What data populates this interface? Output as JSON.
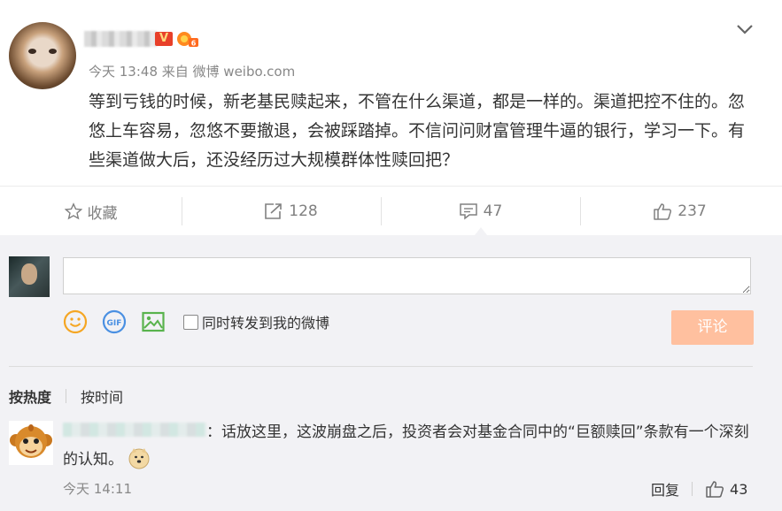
{
  "post": {
    "vip_label": "V",
    "meta": "今天 13:48 来自 微博 weibo.com",
    "text": "等到亏钱的时候，新老基民赎起来，不管在什么渠道，都是一样的。渠道把控不住的。忽悠上车容易，忽悠不要撤退，会被踩踏掉。不信问问财富管理牛逼的银行，学习一下。有些渠道做大后，还没经历过大规模群体性赎回把？"
  },
  "actions": {
    "favorite_label": "收藏",
    "repost_count": "128",
    "comment_count": "47",
    "like_count": "237"
  },
  "composer": {
    "input_value": "",
    "repost_label": "同时转发到我的微博",
    "submit_label": "评论"
  },
  "sort": {
    "hot_label": "按热度",
    "time_label": "按时间"
  },
  "comment": {
    "text": "：话放这里，这波崩盘之后，投资者会对基金合同中的“巨额赎回”条款有一个深刻的认知。",
    "time": "今天 14:11",
    "reply_label": "回复",
    "like_count": "43"
  },
  "colors": {
    "accent_orange": "#ff8140",
    "submit_disabled": "#ffc09f",
    "icon_gray": "#808080",
    "bg_comment": "#f2f2f5"
  },
  "icons": [
    "chevron-down-icon",
    "star-icon",
    "repost-icon",
    "comment-icon",
    "like-icon",
    "emoji-icon",
    "gif-icon",
    "image-icon"
  ]
}
